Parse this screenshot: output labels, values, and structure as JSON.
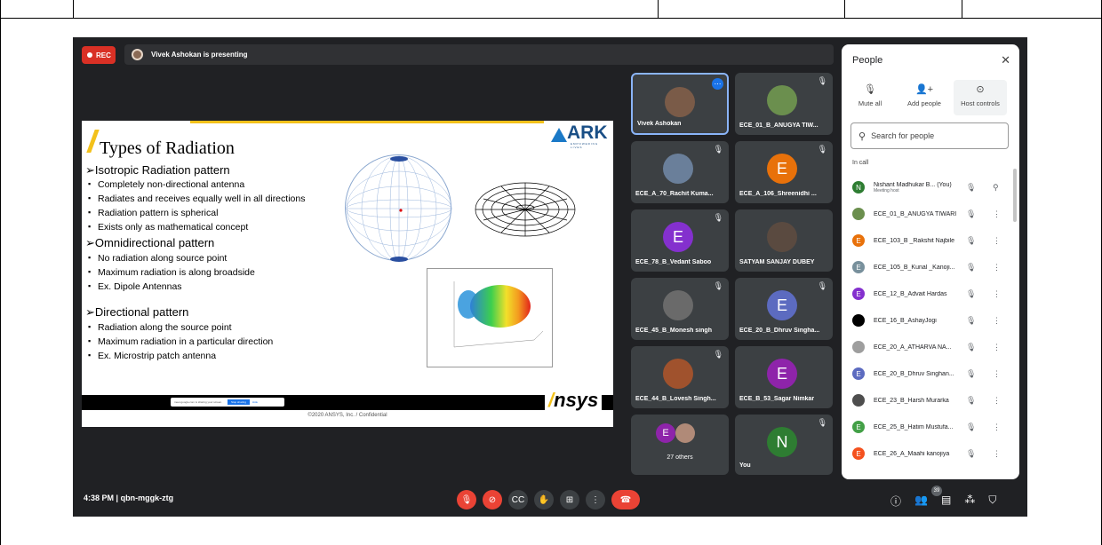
{
  "rec_label": "REC",
  "presenting_text": "Vivek Ashokan is presenting",
  "slide": {
    "title": "Types of Radiation",
    "logo_text": "ARK",
    "logo_sub": "EMPOWERING LIVES",
    "sections": [
      {
        "heading": "➢Isotropic Radiation pattern",
        "bullets": [
          "Completely non-directional antenna",
          "Radiates and receives equally well in all directions",
          "Radiation pattern is spherical",
          "Exists only as mathematical concept"
        ]
      },
      {
        "heading": "➢Omnidirectional pattern",
        "bullets": [
          "No radiation along source point",
          "Maximum radiation is along broadside",
          "Ex. Dipole Antennas"
        ]
      },
      {
        "heading": "➢Directional pattern",
        "bullets": [
          "Radiation along the source point",
          "Maximum radiation in a particular direction",
          "Ex. Microstrip patch antenna"
        ]
      }
    ],
    "footer_logo": "nsys",
    "copyright": "©2020 ANSYS, Inc. / Confidential",
    "share_bar": {
      "text": "meet.google.com is sharing your screen.",
      "stop": "Stop sharing",
      "hide": "Hide"
    }
  },
  "tiles": [
    {
      "name": "Vivek Ashokan",
      "initial": "",
      "color": "#7a5b48",
      "photo": true
    },
    {
      "name": "ECE_01_B_ANUGYA TIW...",
      "initial": "",
      "color": "#6b8f4e",
      "photo": true
    },
    {
      "name": "ECE_A_70_Rachit Kuma...",
      "initial": "",
      "color": "#6a7f9a",
      "photo": true
    },
    {
      "name": "ECE_A_106_Shreenidhi ...",
      "initial": "E",
      "color": "#e8710a",
      "photo": false
    },
    {
      "name": "ECE_78_B_Vedant Saboo",
      "initial": "E",
      "color": "#8430ce",
      "photo": false
    },
    {
      "name": "SATYAM SANJAY DUBEY",
      "initial": "",
      "color": "#5a4a40",
      "photo": true
    },
    {
      "name": "ECE_45_B_Monesh singh",
      "initial": "",
      "color": "#6a6a6a",
      "photo": true
    },
    {
      "name": "ECE_20_B_Dhruv Singha...",
      "initial": "E",
      "color": "#5c6bc0",
      "photo": false
    },
    {
      "name": "ECE_44_B_Lovesh Singh...",
      "initial": "",
      "color": "#a0522d",
      "photo": true
    },
    {
      "name": "ECE_B_53_Sagar Nimkar",
      "initial": "E",
      "color": "#8e24aa",
      "photo": false
    },
    {
      "name": "27 others",
      "initial": "E",
      "color": "#8e24aa",
      "photo": false
    },
    {
      "name": "You",
      "initial": "N",
      "color": "#2e7d32",
      "photo": false
    }
  ],
  "bottom": {
    "time": "4:38 PM",
    "separator": "|",
    "meeting_code": "qbn-mggk-ztg",
    "participant_count": "39"
  },
  "people_panel": {
    "title": "People",
    "mute_all": "Mute all",
    "add_people": "Add people",
    "host_controls": "Host controls",
    "search_placeholder": "Search for people",
    "in_call": "In call",
    "host_label": "Meeting host",
    "participants": [
      {
        "name": "Nishant Madhukar B... (You)",
        "initial": "N",
        "color": "#2e7d32"
      },
      {
        "name": "ECE_01_B_ANUGYA TIWARI",
        "initial": "",
        "color": "#6b8f4e"
      },
      {
        "name": "ECE_103_B _Rakshit Najbile",
        "initial": "E",
        "color": "#e8710a"
      },
      {
        "name": "ECE_105_B_Kunal _Kanoji...",
        "initial": "E",
        "color": "#78909c"
      },
      {
        "name": "ECE_12_B_Advait Hardas",
        "initial": "E",
        "color": "#8430ce"
      },
      {
        "name": "ECE_16_B_AshayJogi",
        "initial": "",
        "color": "#000000"
      },
      {
        "name": "ECE_20_A_ATHARVA NA...",
        "initial": "",
        "color": "#9e9e9e"
      },
      {
        "name": "ECE_20_B_Dhruv Singhan...",
        "initial": "E",
        "color": "#5c6bc0"
      },
      {
        "name": "ECE_23_B_Harsh Murarka",
        "initial": "",
        "color": "#4e4e4e"
      },
      {
        "name": "ECE_25_B_Hatim Mustufa...",
        "initial": "E",
        "color": "#43a047"
      },
      {
        "name": "ECE_26_A_Maahi kanojiya",
        "initial": "E",
        "color": "#f4511e"
      }
    ]
  }
}
